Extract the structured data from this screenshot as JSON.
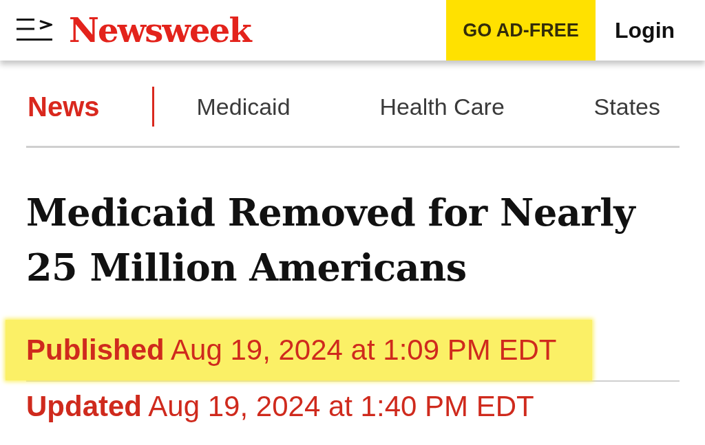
{
  "header": {
    "logo": "Newsweek",
    "ad_free_button": "GO AD-FREE",
    "login_link": "Login"
  },
  "nav": {
    "tabs": [
      {
        "label": "News",
        "selected": true
      },
      {
        "label": "Medicaid",
        "selected": false
      },
      {
        "label": "Health Care",
        "selected": false
      },
      {
        "label": "States",
        "selected": false
      }
    ]
  },
  "article": {
    "headline": "Medicaid Removed for Nearly 25 Million Americans",
    "dates": [
      {
        "text": "**Published** Aug 19, 2024 at 1:09 PM EDT",
        "highlighted": true
      },
      {
        "text": "**Updated** Aug 19, 2024 at 1:40 PM EDT",
        "highlighted": false
      }
    ]
  }
}
